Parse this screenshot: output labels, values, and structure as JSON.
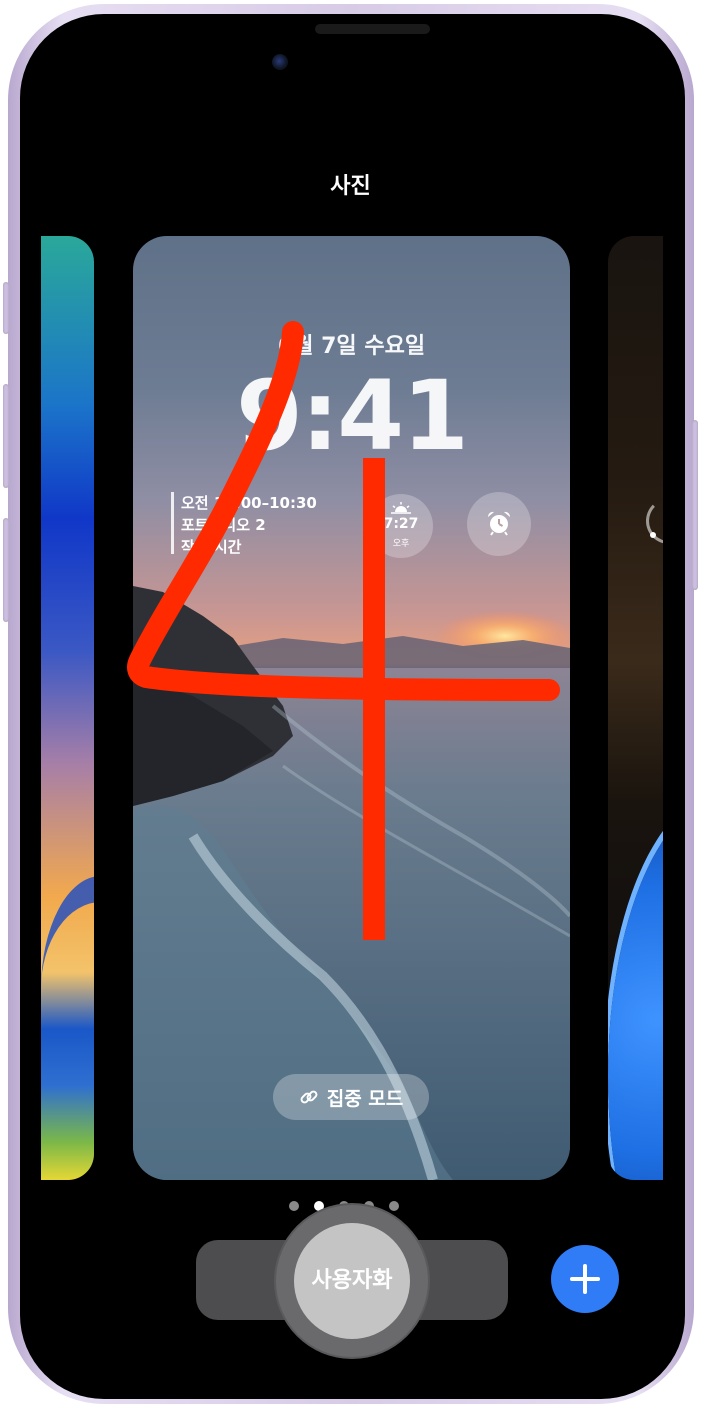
{
  "header": {
    "title": "사진"
  },
  "lock_screen": {
    "date": "6월 7일 수요일",
    "time": "9:41",
    "calendar_widget": {
      "line1": "오전 10:00–10:30",
      "line2": "포트폴리오 2",
      "line3": "작업 시간"
    },
    "sunset_widget": {
      "time": "7:27",
      "label": "오후",
      "icon": "sunrise-icon"
    },
    "alarm_widget": {
      "icon": "alarm-clock-icon"
    },
    "focus_button": {
      "label": "집중 모드",
      "icon": "link-icon"
    }
  },
  "pager": {
    "count": 5,
    "active_index": 1
  },
  "bottom_bar": {
    "customize_label": "사용자화",
    "add_icon": "plus-icon",
    "add_color": "#2f7cf6"
  },
  "gesture_annotation": {
    "color": "#ff2a00",
    "shape": "4"
  }
}
